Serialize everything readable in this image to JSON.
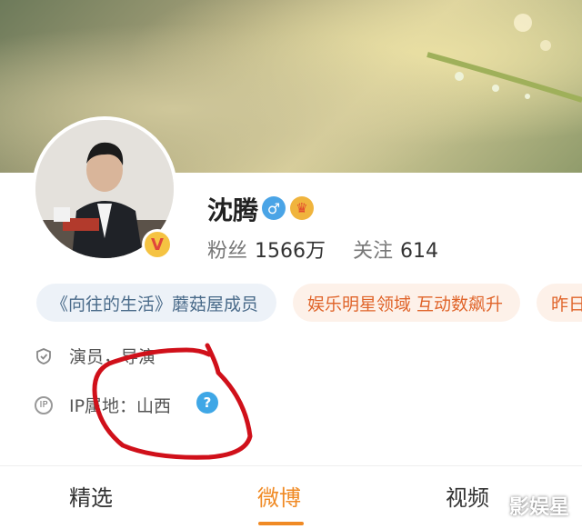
{
  "profile": {
    "name": "沈腾",
    "gender_icon": "male-icon",
    "vip_icon": "crown-icon",
    "fans_label": "粉丝",
    "fans_value": "1566万",
    "follow_label": "关注",
    "follow_value": "614"
  },
  "tags": [
    "《向往的生活》蘑菇屋成员",
    "娱乐明星领域 互动数飙升",
    "昨日"
  ],
  "info": {
    "occupation": "演员，导演",
    "ip_location": "IP属地：山西"
  },
  "tabs": [
    {
      "label": "精选"
    },
    {
      "label": "微博",
      "active": true
    },
    {
      "label": "视频"
    }
  ],
  "watermark": "影娱星",
  "colors": {
    "accent": "#f08a24",
    "tag_blue_bg": "#edf2f8",
    "tag_orange_text": "#e0652b",
    "annotation_red": "#d0101a"
  }
}
